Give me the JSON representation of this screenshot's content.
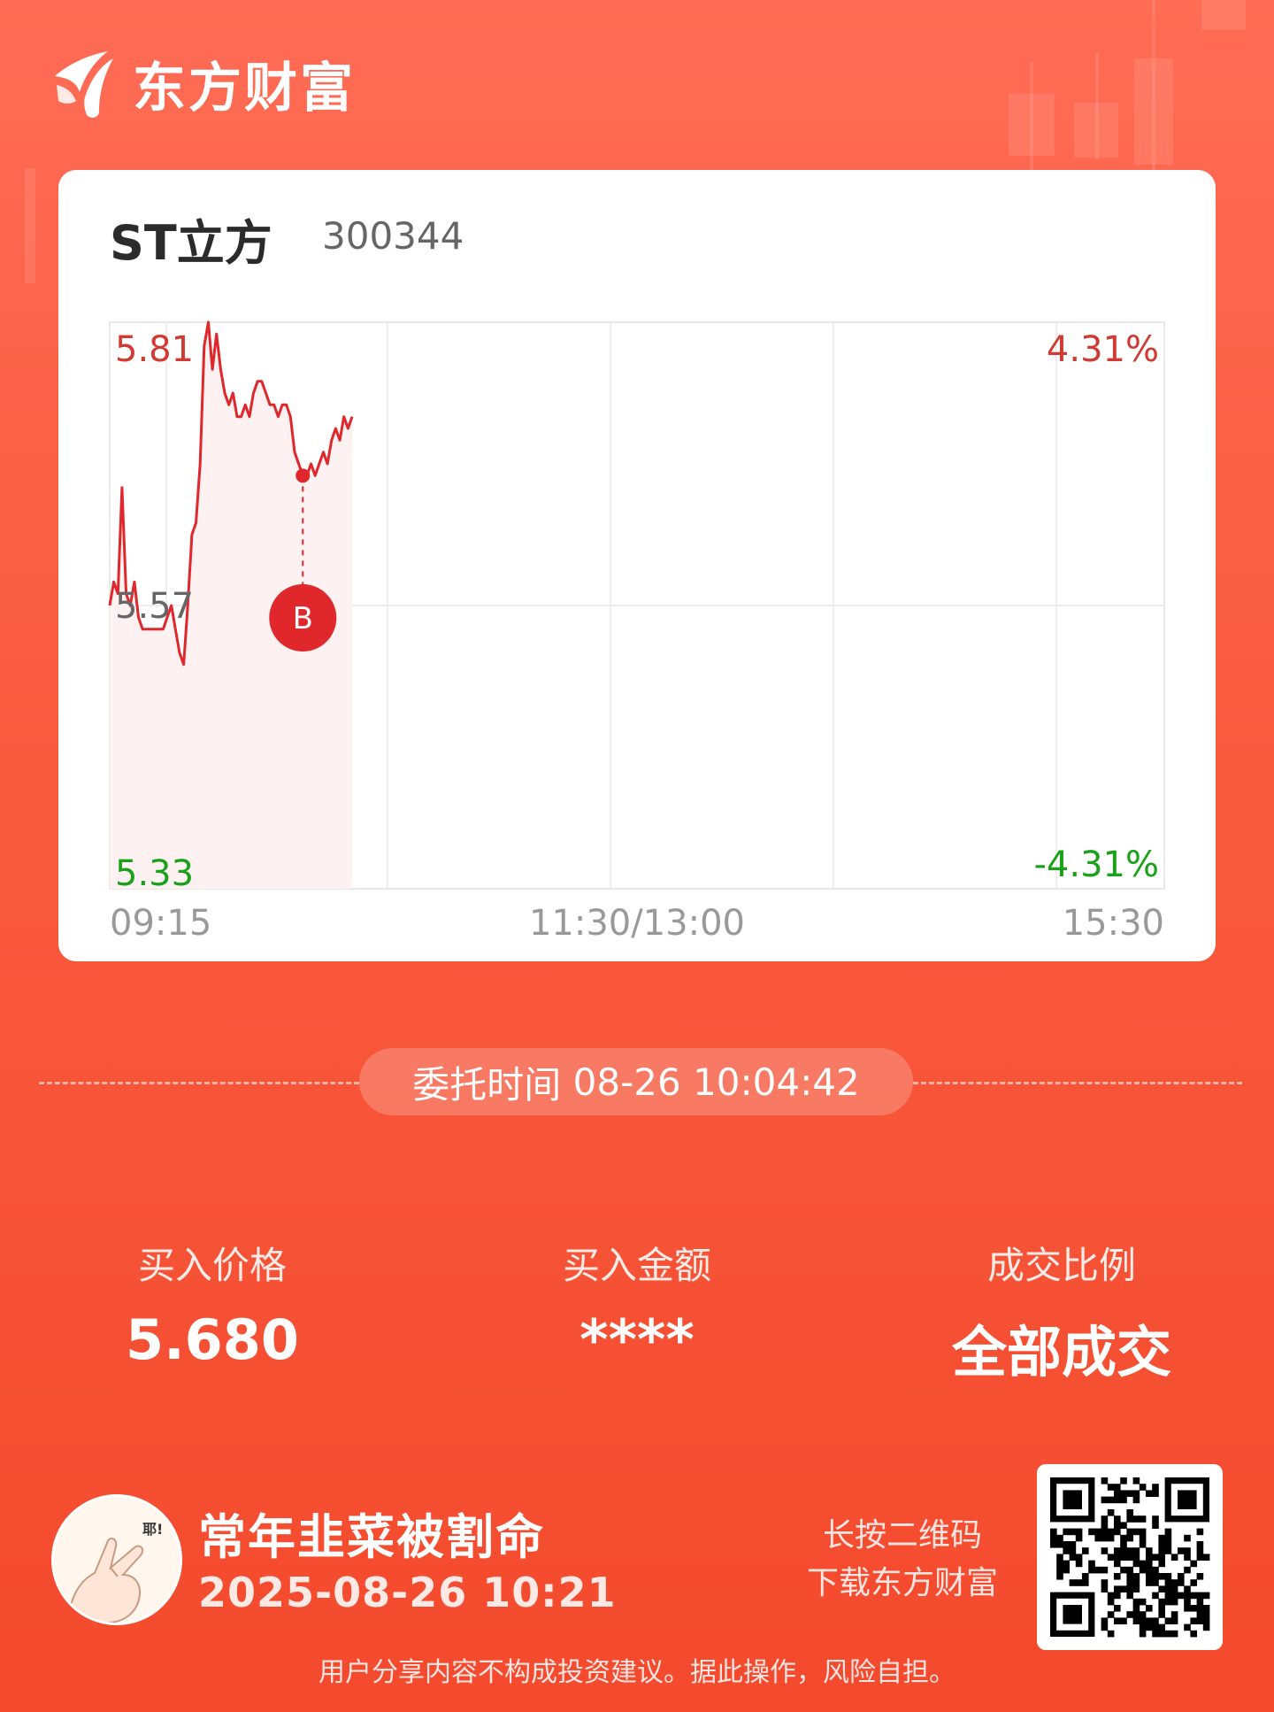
{
  "brand": {
    "name": "东方财富",
    "logo_icon": "eastmoney-logo-icon"
  },
  "stock": {
    "name": "ST立方",
    "code": "300344"
  },
  "chart_data": {
    "type": "line",
    "title": "",
    "y_left_labels": {
      "top": "5.81",
      "middle": "5.57",
      "bottom": "5.33"
    },
    "y_right_labels": {
      "top": "4.31%",
      "bottom": "-4.31%"
    },
    "x_labels": [
      "09:15",
      "11:30/13:00",
      "15:30"
    ],
    "ylim": [
      5.33,
      5.81
    ],
    "prev_close": 5.57,
    "series": [
      {
        "values": [
          5.57,
          5.59,
          5.58,
          5.67,
          5.58,
          5.57,
          5.59,
          5.56,
          5.55,
          5.55,
          5.55,
          5.55,
          5.55,
          5.55,
          5.56,
          5.57,
          5.55,
          5.53,
          5.52,
          5.57,
          5.63,
          5.64,
          5.69,
          5.79,
          5.81,
          5.77,
          5.8,
          5.77,
          5.75,
          5.74,
          5.75,
          5.73,
          5.73,
          5.74,
          5.73,
          5.75,
          5.76,
          5.76,
          5.75,
          5.74,
          5.74,
          5.73,
          5.74,
          5.74,
          5.73,
          5.7,
          5.69,
          5.68,
          5.68,
          5.69,
          5.68,
          5.69,
          5.7,
          5.69,
          5.71,
          5.72,
          5.71,
          5.73,
          5.72,
          5.73
        ]
      }
    ],
    "buy_marker": {
      "label": "B",
      "price": 5.68,
      "time": "10:04"
    },
    "colors": {
      "line": "#e0272c",
      "up": "#d13a32",
      "down": "#19a11a",
      "mid": "#666666",
      "fill": "#fdf1f1"
    }
  },
  "order_time": {
    "label": "委托时间",
    "value": "08-26 10:04:42"
  },
  "stats": [
    {
      "label": "买入价格",
      "value": "5.680"
    },
    {
      "label": "买入金额",
      "value": "****"
    },
    {
      "label": "成交比例",
      "value": "全部成交"
    }
  ],
  "user": {
    "name": "常年韭菜被割命",
    "time": "2025-08-26 10:21",
    "avatar_icon": "hand-avatar-icon",
    "avatar_text": "耶!"
  },
  "qr": {
    "hint_line1": "长按二维码",
    "hint_line2": "下载东方财富",
    "icon": "qr-code-icon"
  },
  "disclaimer": "用户分享内容不构成投资建议。据此操作，风险自担。"
}
